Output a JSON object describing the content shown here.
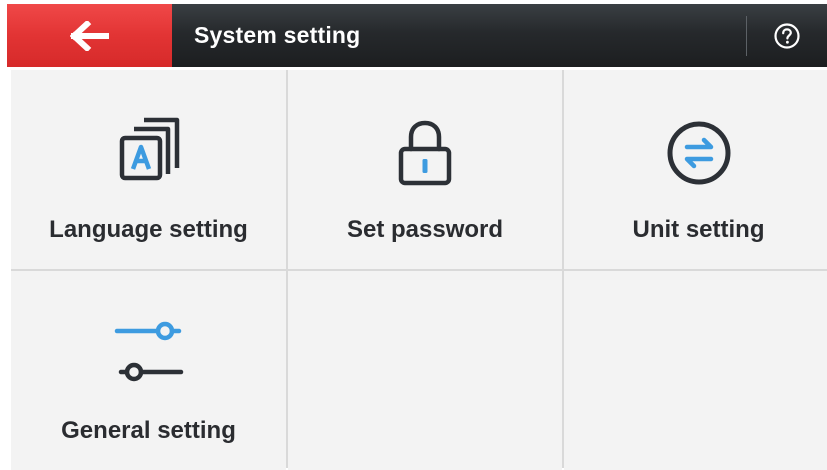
{
  "header": {
    "title": "System setting",
    "back_icon": "arrow-left-icon",
    "help_icon": "question-circle-icon"
  },
  "tiles": [
    {
      "label": "Language setting",
      "icon": "language-icon"
    },
    {
      "label": "Set password",
      "icon": "lock-icon"
    },
    {
      "label": "Unit setting",
      "icon": "swap-arrows-icon"
    },
    {
      "label": "General setting",
      "icon": "sliders-icon"
    }
  ],
  "colors": {
    "accent_red": "#e23434",
    "header_dark": "#26292c",
    "icon_dark": "#2c3036",
    "icon_blue": "#3d9be0",
    "tile_bg": "#f3f3f3"
  }
}
